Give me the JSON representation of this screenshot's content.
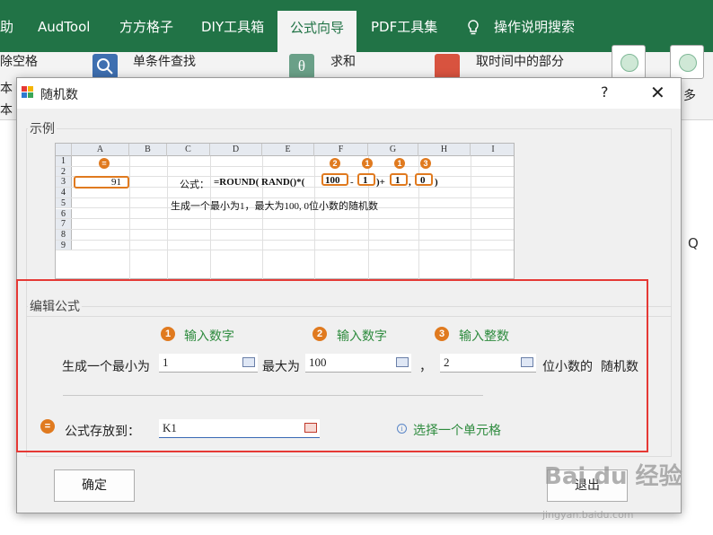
{
  "ribbon": {
    "tabs": [
      "助",
      "AudTool",
      "方方格子",
      "DIY工具箱",
      "公式向导",
      "PDF工具集",
      "操作说明搜索"
    ],
    "buttons": [
      "除空格",
      "单条件查找",
      "求和",
      "取时间中的部分",
      "多"
    ],
    "side_labels": [
      "本",
      "本",
      "ᄂ"
    ]
  },
  "sheet": {
    "col_q": "Q"
  },
  "dialog": {
    "title": "随机数",
    "help": "?",
    "close": "✕",
    "example": {
      "group_label": "示例",
      "col_headers": [
        "",
        "A",
        "B",
        "C",
        "D",
        "E",
        "F",
        "G",
        "H",
        "I"
      ],
      "row_numbers": [
        "1",
        "2",
        "3",
        "4",
        "5",
        "6",
        "7",
        "8",
        "9"
      ],
      "cell_a3": "91",
      "formula_label": "公式：",
      "formula_prefix": "=ROUND( RAND()*(",
      "arg_max": "100",
      "minus": "-",
      "arg_min": "1",
      "plus": ")+",
      "arg_min2": "1",
      "comma": ",",
      "arg_digits": "0",
      "close_paren": ")",
      "description": "生成一个最小为1，最大为100, 0位小数的随机数",
      "badges": [
        "=",
        "2",
        "1",
        "1",
        "3"
      ]
    },
    "edit": {
      "group_label": "编辑公式",
      "steps": [
        {
          "badge": "1",
          "hint": "输入数字"
        },
        {
          "badge": "2",
          "hint": "输入数字"
        },
        {
          "badge": "3",
          "hint": "输入整数"
        }
      ],
      "gen_min_label": "生成一个最小为",
      "min_value": "1",
      "max_label": "最大为",
      "max_value": "100",
      "comma": "，",
      "digits_value": "2",
      "digits_label": "位小数的",
      "random_label": "随机数",
      "store_badge": "=",
      "store_label": "公式存放到：",
      "store_value": "K1",
      "info_text": "选择一个单元格"
    },
    "ok_label": "确定",
    "exit_label": "退出"
  },
  "watermark": {
    "brand": "Bai du 经验",
    "url": "jingyan.baidu.com"
  },
  "colors": {
    "excel_green": "#217346",
    "accent_orange": "#e07a1f",
    "hint_green": "#2e8b3e",
    "highlight_red": "#e53935"
  }
}
